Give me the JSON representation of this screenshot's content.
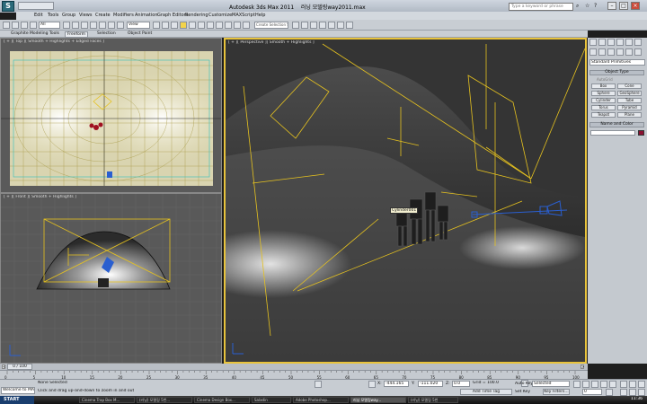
{
  "window": {
    "app_title": "Autodesk 3ds Max  2011",
    "file_title": "러닝 모델링way2011.max",
    "search_placeholder": "Type a keyword or phrase"
  },
  "menu": [
    "Edit",
    "Tools",
    "Group",
    "Views",
    "Create",
    "Modifiers",
    "Animation",
    "Graph Editors",
    "Rendering",
    "Customize",
    "MAXScript",
    "Help"
  ],
  "toolbar": {
    "selection_filter": "All",
    "ref_coord": "View",
    "named_selection": "Create Selection Set"
  },
  "ribbon_tabs": [
    "Graphite Modeling Tools",
    "Freeform",
    "Selection",
    "Object Paint"
  ],
  "viewports": {
    "top": "[ + ][ Top ][ Smooth + Highlights + Edged Faces ]",
    "front": "[ + ][ Front ][ Smooth + Highlights ]",
    "perspective": "[ + ][ Perspective ][ Smooth + Highlights ]",
    "object_tooltip": "Cylinder001"
  },
  "command_panel": {
    "category": "Standard Primitives",
    "object_type_header": "Object Type",
    "autogrid": "AutoGrid",
    "buttons": [
      "Box",
      "Cone",
      "Sphere",
      "GeoSphere",
      "Cylinder",
      "Tube",
      "Torus",
      "Pyramid",
      "Teapot",
      "Plane"
    ],
    "name_color_header": "Name and Color"
  },
  "timeline": {
    "frame_counter": "0 / 100",
    "ticks": [
      "0",
      "5",
      "10",
      "15",
      "20",
      "25",
      "30",
      "35",
      "40",
      "45",
      "50",
      "55",
      "60",
      "65",
      "70",
      "75",
      "80",
      "85",
      "90",
      "95",
      "100"
    ]
  },
  "status": {
    "welcome": "Welcome to MA",
    "selection": "None Selected",
    "prompt": "Click and drag up-and-down to zoom in and out",
    "x_label": "X:",
    "x_value": "-444.165",
    "y_label": "Y:",
    "y_value": "-111.020",
    "z_label": "Z:",
    "z_value": "0.0",
    "grid": "Grid = 100.0",
    "add_time_tag": "Add Time Tag",
    "auto_key": "Auto Key",
    "set_key": "Set Key",
    "key_mode": "Selected",
    "key_filters": "Key Filters...",
    "frame": "0"
  },
  "taskbar": {
    "start": "START",
    "tasks": [
      "Cinema Trap Box M...",
      "(러닝) 모델링 5번...",
      "Cinema Design Box...",
      "Saladin",
      "Adobe Photoshop...",
      "러닝 모델링way...",
      "(러닝) 모델링 5번"
    ],
    "active_index": 5,
    "clock": "11:36"
  },
  "colors": {
    "viewport_active_border": "#e8c33c",
    "wireframe_yellow": "#e6c21f",
    "light_blue": "#2a5fd0",
    "name_color_swatch": "#8a1030"
  }
}
